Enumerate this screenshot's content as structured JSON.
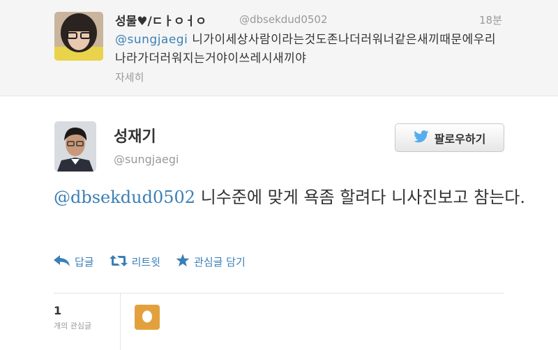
{
  "reply_tweet": {
    "display_name": "성물♥/ㄷㅏㅇㅓㅇ",
    "handle": "@dbsekdud0502",
    "time": "18분",
    "mention": "@sungjaegi",
    "text": " 니가이세상사람이라는것도존나더러워너같은새끼때문에우리나라가더러워지는거야이쓰레시새끼야",
    "detail_link": "자세히"
  },
  "main_tweet": {
    "display_name": "성재기",
    "handle": "@sungjaegi",
    "follow_label": "팔로우하기",
    "mention": "@dbsekdud0502",
    "text": " 니수준에 맞게 욕좀 할려다 니사진보고 참는다."
  },
  "actions": {
    "reply": "답글",
    "retweet": "리트윗",
    "favorite": "관심글 담기"
  },
  "stats": {
    "favorite_count": "1",
    "favorite_label": "개의 관심글"
  },
  "colors": {
    "link": "#3b7fb5",
    "twitter_bird": "#55acee",
    "egg_avatar": "#e3a13d"
  }
}
